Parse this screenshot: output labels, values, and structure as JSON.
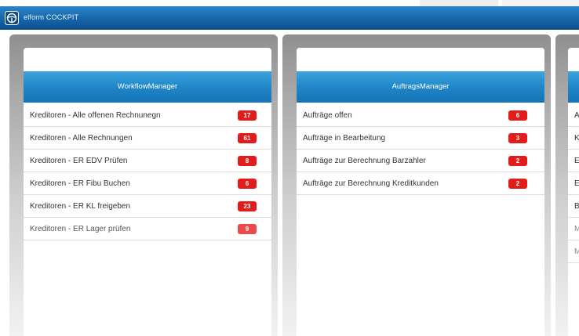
{
  "app": {
    "title": "elform COCKPIT",
    "logo_icon": "steering-wheel-icon"
  },
  "colors": {
    "accent": "#1f86c9",
    "badge": "#e21b1b"
  },
  "panels": [
    {
      "header": "WorkflowManager",
      "items": [
        {
          "label": "Kreditoren - Alle offenen Rechnunegn",
          "count": "17"
        },
        {
          "label": "Kreditoren - Alle Rechnungen",
          "count": "61"
        },
        {
          "label": "Kreditoren - ER EDV Prüfen",
          "count": "8"
        },
        {
          "label": "Kreditoren - ER Fibu Buchen",
          "count": "6"
        },
        {
          "label": "Kreditoren - ER KL freigeben",
          "count": "23"
        },
        {
          "label": "Kreditoren - ER Lager prüfen",
          "count": "9"
        }
      ]
    },
    {
      "header": "AuftragsManager",
      "items": [
        {
          "label": "Aufträge offen",
          "count": "6"
        },
        {
          "label": "Aufträge in Bearbeitung",
          "count": "3"
        },
        {
          "label": "Aufträge zur Berechnung Barzahler",
          "count": "2"
        },
        {
          "label": "Aufträge zur Berechnung Kreditkunden",
          "count": "2"
        }
      ]
    },
    {
      "items": [
        {
          "label": "A"
        },
        {
          "label": "K"
        },
        {
          "label": "E"
        },
        {
          "label": "E"
        },
        {
          "label": "B"
        },
        {
          "label": "M"
        },
        {
          "label": "M"
        }
      ]
    }
  ]
}
